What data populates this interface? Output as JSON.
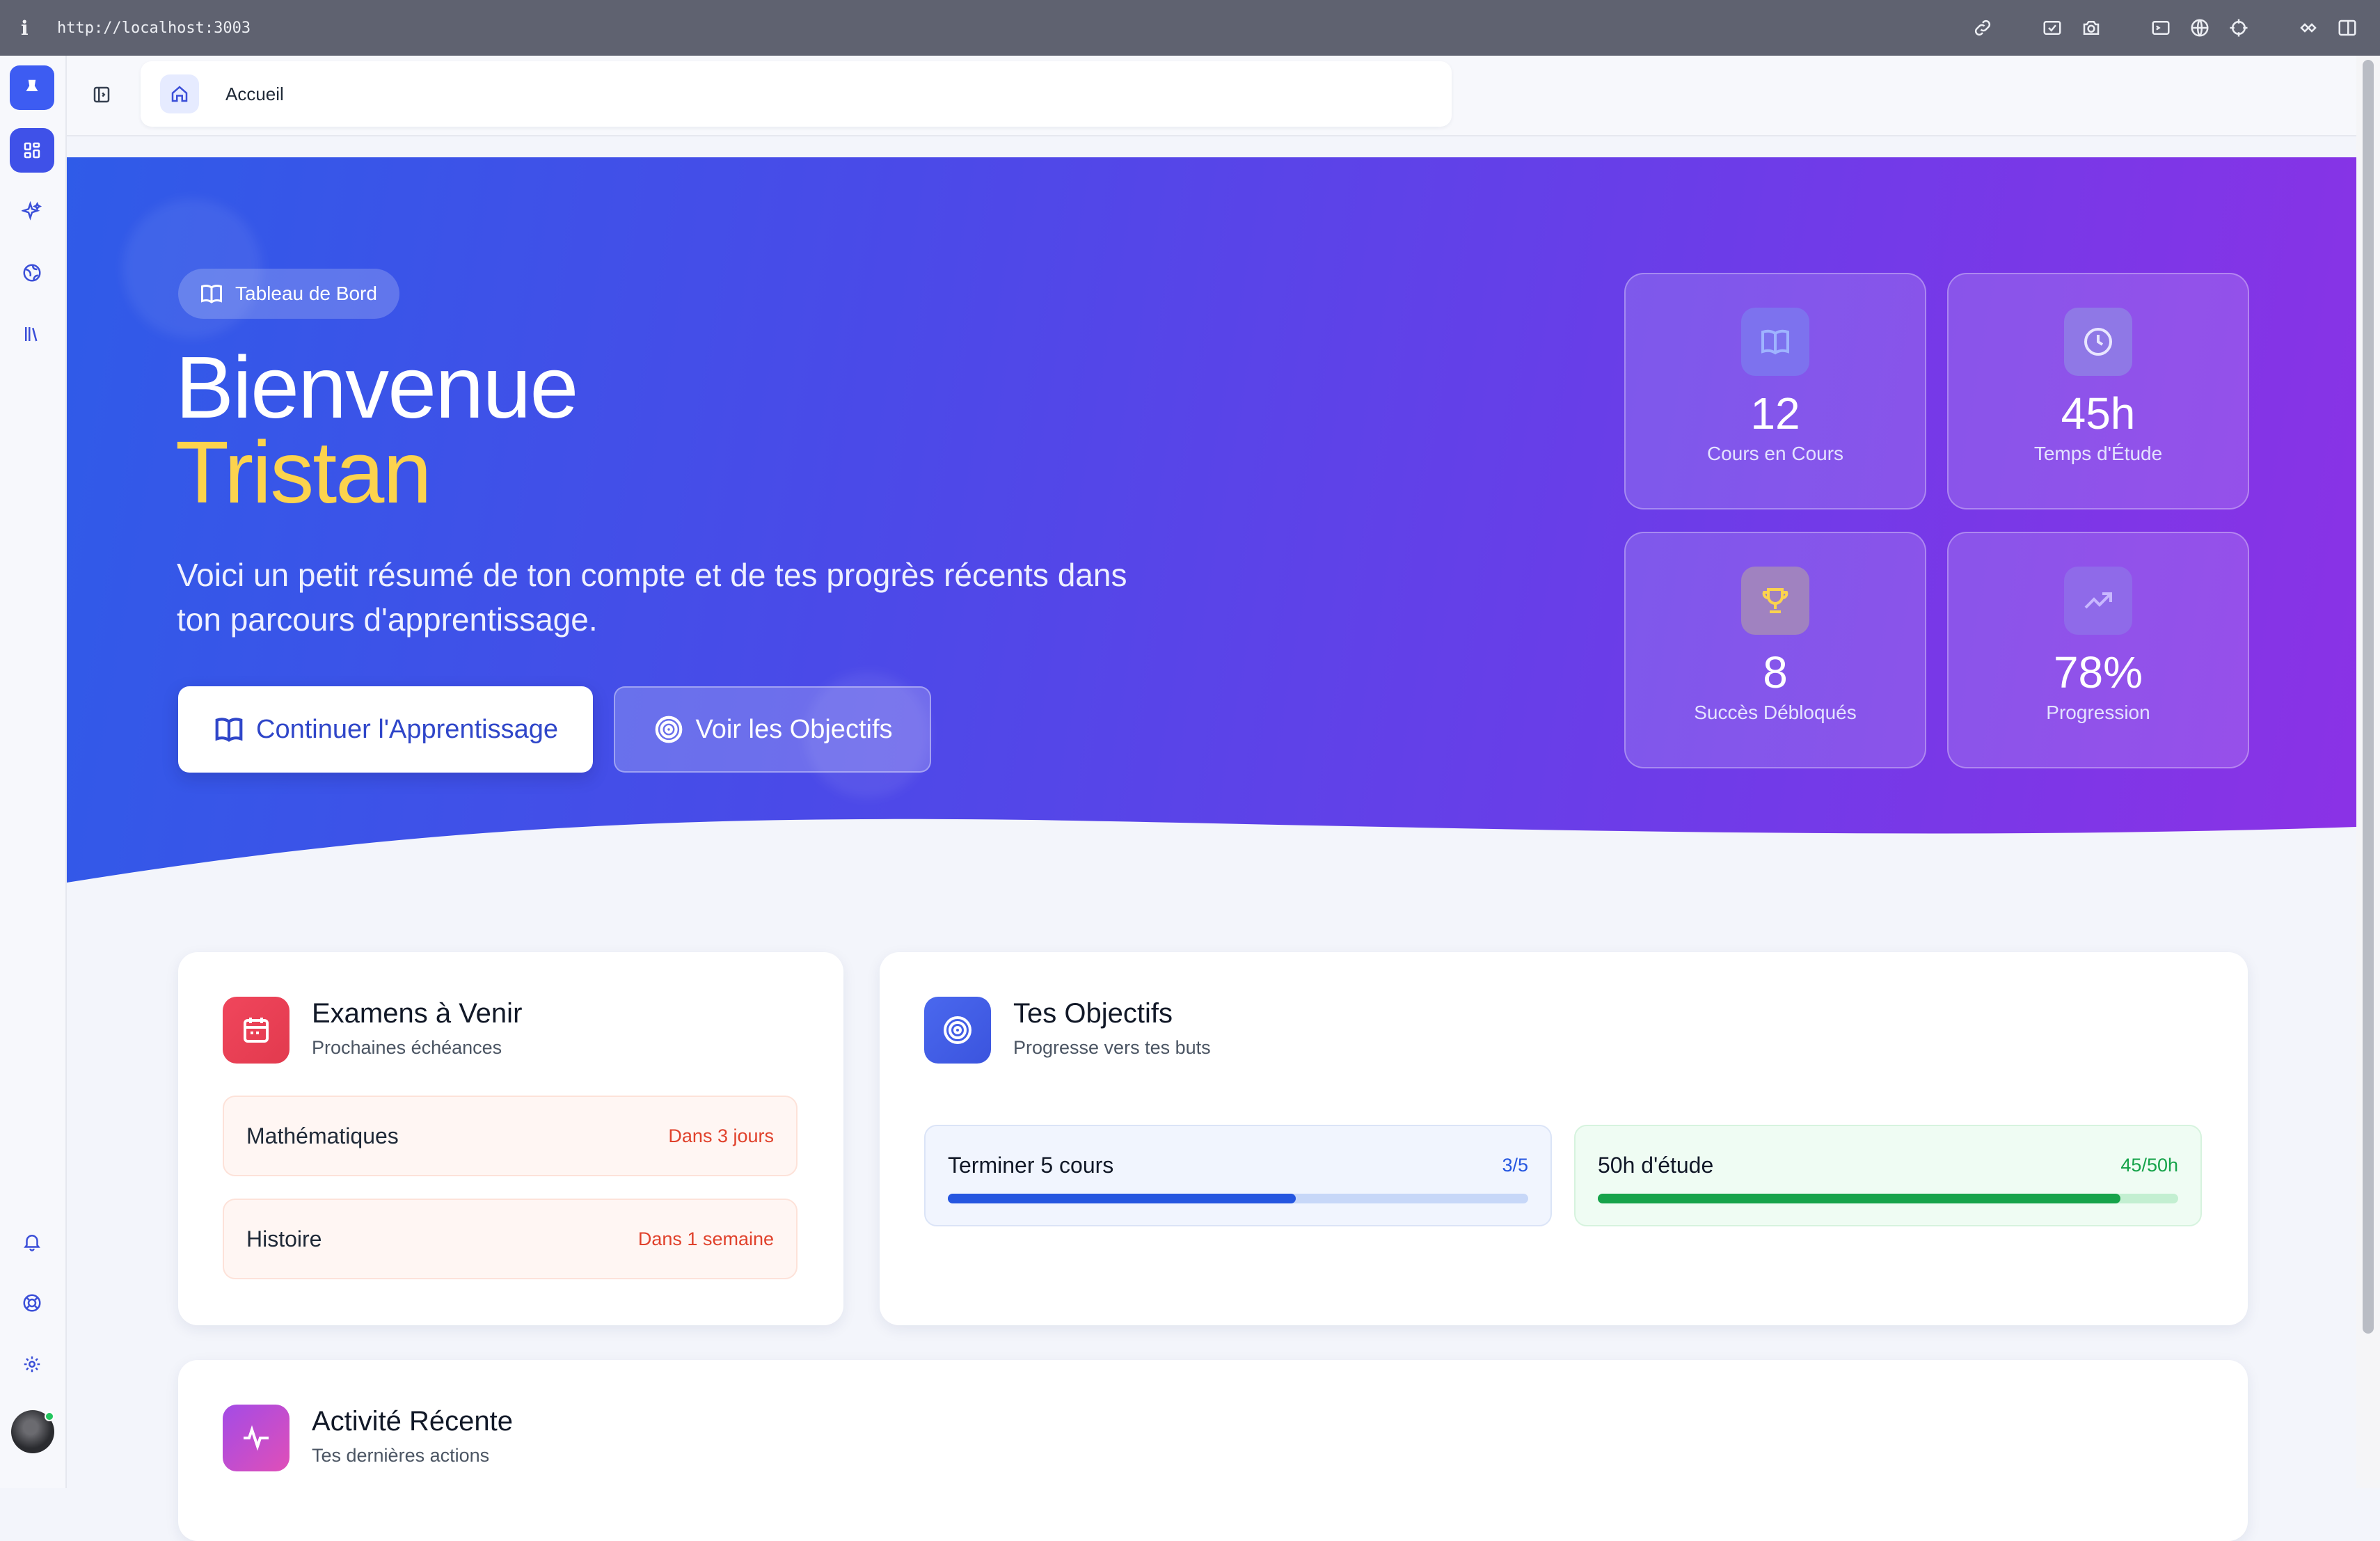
{
  "browser": {
    "url": "http://localhost:3003",
    "info_glyph": "i"
  },
  "breadcrumb": {
    "label": "Accueil"
  },
  "hero": {
    "badge": "Tableau de Bord",
    "greeting": "Bienvenue",
    "name": "Tristan",
    "subtitle": "Voici un petit résumé de ton compte et de tes progrès récents dans ton parcours d'apprentissage.",
    "primary_button": "Continuer l'Apprentissage",
    "secondary_button": "Voir les Objectifs"
  },
  "stats": [
    {
      "icon": "book-icon",
      "value": "12",
      "label": "Cours en Cours",
      "icon_bg": "#7d72ee",
      "icon_color": "#9fb4ff"
    },
    {
      "icon": "clock-icon",
      "value": "45h",
      "label": "Temps d'Étude",
      "icon_bg": "#8f78e6",
      "icon_color": "#e9e6ff"
    },
    {
      "icon": "trophy-icon",
      "value": "8",
      "label": "Succès Débloqués",
      "icon_bg": "#a082c0",
      "icon_color": "#fcd34d"
    },
    {
      "icon": "trending-up-icon",
      "value": "78%",
      "label": "Progression",
      "icon_bg": "#8f6ae9",
      "icon_color": "#c9b8ff"
    }
  ],
  "exams": {
    "title": "Examens à Venir",
    "subtitle": "Prochaines échéances",
    "items": [
      {
        "name": "Mathématiques",
        "due": "Dans 3 jours"
      },
      {
        "name": "Histoire",
        "due": "Dans 1 semaine"
      }
    ]
  },
  "goals": {
    "title": "Tes Objectifs",
    "subtitle": "Progresse vers tes buts",
    "items": [
      {
        "name": "Terminer 5 cours",
        "value": "3/5",
        "progress": 0.6,
        "color": "#2556e0",
        "track": "#c7d7f8",
        "bg": "#f1f5fe",
        "border": "#dbe4f7"
      },
      {
        "name": "50h d'étude",
        "value": "45/50h",
        "progress": 0.9,
        "color": "#16a34a",
        "track": "#c3efd1",
        "bg": "#effcf3",
        "border": "#d6f3de"
      }
    ]
  },
  "activity": {
    "title": "Activité Récente",
    "subtitle": "Tes dernières actions"
  },
  "colors": {
    "accent": "#3f51e8",
    "exam_icon": "#ef4458",
    "goal_icon": "#4560e8",
    "activity_icon": "#c54bd8"
  }
}
